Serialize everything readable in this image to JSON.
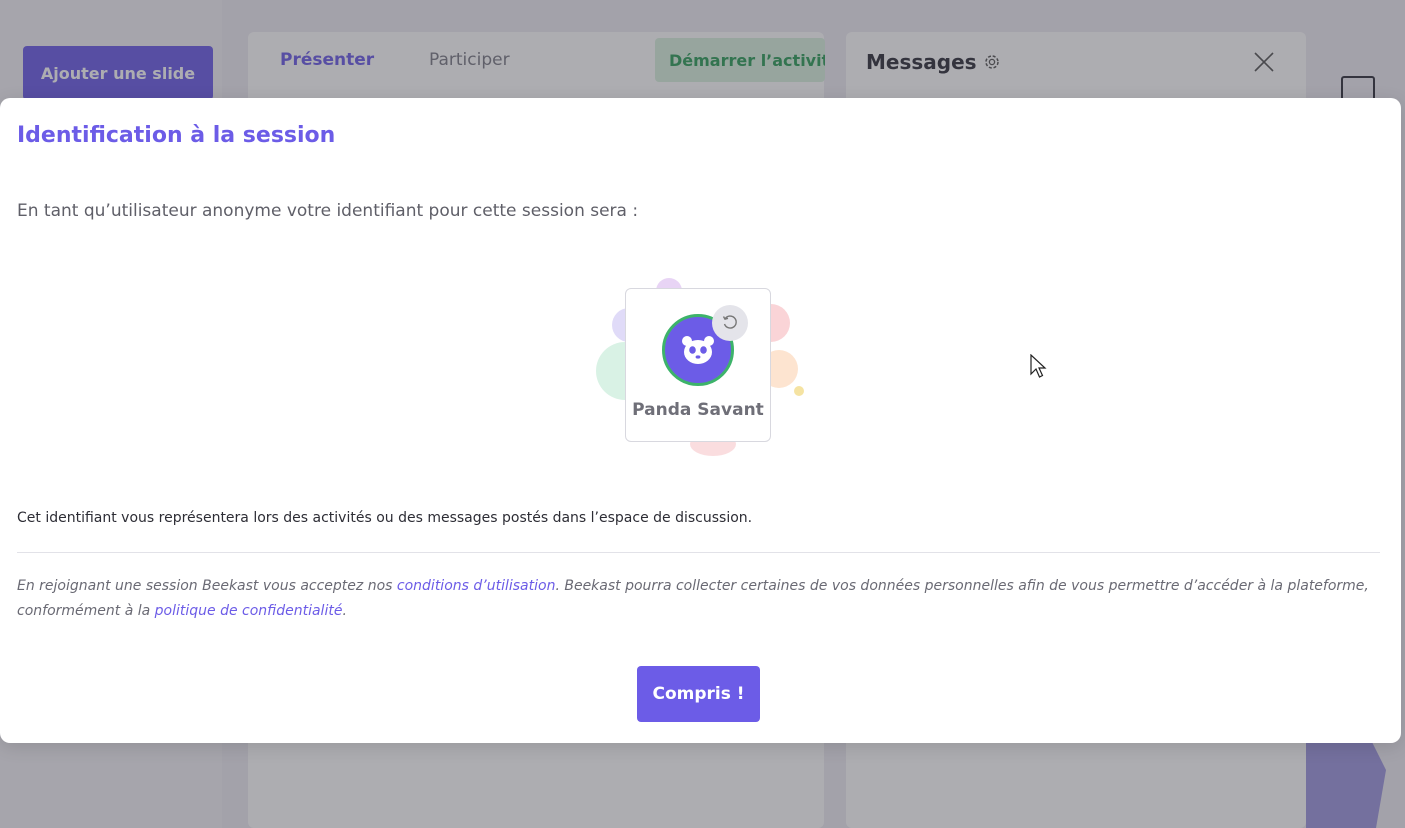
{
  "background": {
    "add_slide_label": "Ajouter une slide",
    "tabs": [
      {
        "label": "Présenter",
        "active": true
      },
      {
        "label": "Participer",
        "active": false
      }
    ],
    "start_activity_label": "Démarrer l’activit",
    "messages_title": "Messages"
  },
  "modal": {
    "title": "Identification à la session",
    "intro": "En tant qu’utilisateur anonyme votre identifiant pour cette session sera :",
    "avatar": {
      "name": "Panda Savant",
      "icon": "panda-icon",
      "color": "#6c5ce7",
      "ring_color": "#3db36a"
    },
    "description": "Cet identifiant vous représentera lors des activités ou des messages postés dans l’espace de discussion.",
    "legal": {
      "part1": "En rejoignant une session Beekast vous acceptez nos ",
      "terms_link": "conditions d’utilisation",
      "part2": ". Beekast pourra collecter certaines de vos données personnelles afin de vous permettre d’accéder à la plateforme, conformément à la ",
      "privacy_link": "politique de confidentialité",
      "part3": "."
    },
    "confirm_label": "Compris !"
  },
  "colors": {
    "accent": "#6c5ce7",
    "success": "#3db36a"
  }
}
